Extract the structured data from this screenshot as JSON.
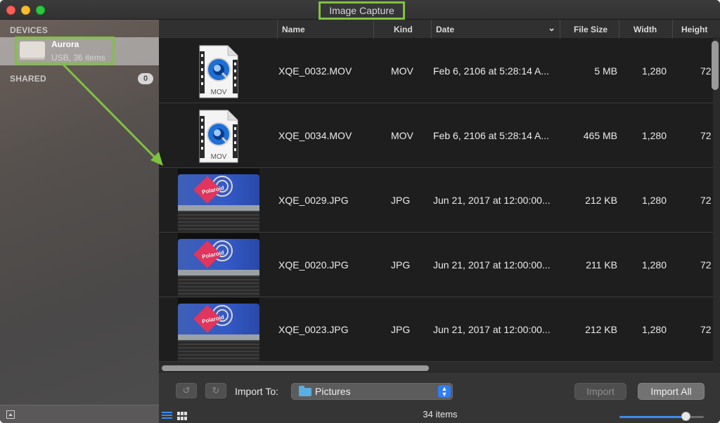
{
  "window": {
    "title": "Image Capture"
  },
  "sidebar": {
    "devices_heading": "DEVICES",
    "device": {
      "name": "Aurora",
      "subtitle": "USB, 36 items"
    },
    "shared_heading": "SHARED",
    "shared_count": "0"
  },
  "columns": [
    {
      "key": "name",
      "label": "Name"
    },
    {
      "key": "kind",
      "label": "Kind"
    },
    {
      "key": "date",
      "label": "Date"
    },
    {
      "key": "size",
      "label": "File Size"
    },
    {
      "key": "width",
      "label": "Width"
    },
    {
      "key": "height",
      "label": "Height"
    }
  ],
  "date_sort_indicator": "⌄",
  "files": [
    {
      "name": "XQE_0032.MOV",
      "kind": "MOV",
      "date": "Feb 6, 2106 at 5:28:14 A...",
      "size": "5 MB",
      "width": "1,280",
      "height": "72",
      "thumb": "mov"
    },
    {
      "name": "XQE_0034.MOV",
      "kind": "MOV",
      "date": "Feb 6, 2106 at 5:28:14 A...",
      "size": "465 MB",
      "width": "1,280",
      "height": "72",
      "thumb": "mov"
    },
    {
      "name": "XQE_0029.JPG",
      "kind": "JPG",
      "date": "Jun 21, 2017 at 12:00:00...",
      "size": "212 KB",
      "width": "1,280",
      "height": "72",
      "thumb": "photo"
    },
    {
      "name": "XQE_0020.JPG",
      "kind": "JPG",
      "date": "Jun 21, 2017 at 12:00:00...",
      "size": "211 KB",
      "width": "1,280",
      "height": "72",
      "thumb": "photo"
    },
    {
      "name": "XQE_0023.JPG",
      "kind": "JPG",
      "date": "Jun 21, 2017 at 12:00:00...",
      "size": "212 KB",
      "width": "1,280",
      "height": "72",
      "thumb": "photo"
    }
  ],
  "mov_icon_label": "MOV",
  "photo_logo_text": "Polaroid",
  "bottom": {
    "rotate_left": "↺",
    "rotate_right": "↻",
    "import_to_label": "Import To:",
    "import_destination": "Pictures",
    "import_label": "Import",
    "import_all_label": "Import All",
    "item_count": "34 items",
    "zoom_level": 0.78
  },
  "colors": {
    "accent": "#3a8cf0",
    "annotation": "#7fc242"
  }
}
